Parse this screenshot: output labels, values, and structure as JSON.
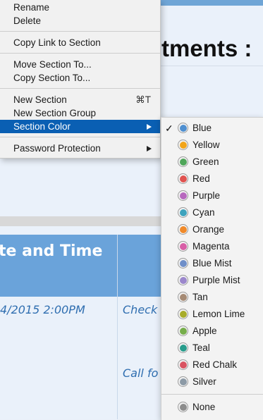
{
  "document": {
    "title": "tments :",
    "table_header": "te and Time",
    "row1_date": "4/2015 2:00PM",
    "row1_action": "Check",
    "row2_action": "Call fo"
  },
  "context_menu": {
    "rename": "Rename",
    "delete": "Delete",
    "copy_link": "Copy Link to Section",
    "move_section": "Move Section To...",
    "copy_section": "Copy Section To...",
    "new_section": "New Section",
    "new_section_shortcut": "⌘T",
    "new_section_group": "New Section Group",
    "section_color": "Section Color",
    "password_protection": "Password Protection"
  },
  "color_submenu": {
    "selected": "Blue",
    "check_glyph": "✓",
    "colors": [
      {
        "label": "Blue",
        "hex": "#4f8fd0"
      },
      {
        "label": "Yellow",
        "hex": "#f2a51a"
      },
      {
        "label": "Green",
        "hex": "#4fa65a"
      },
      {
        "label": "Red",
        "hex": "#e0524f"
      },
      {
        "label": "Purple",
        "hex": "#b768be"
      },
      {
        "label": "Cyan",
        "hex": "#3ea3bd"
      },
      {
        "label": "Orange",
        "hex": "#f08a2a"
      },
      {
        "label": "Magenta",
        "hex": "#d85ea6"
      },
      {
        "label": "Blue Mist",
        "hex": "#6f8fc9"
      },
      {
        "label": "Purple Mist",
        "hex": "#9b87cc"
      },
      {
        "label": "Tan",
        "hex": "#a58a74"
      },
      {
        "label": "Lemon Lime",
        "hex": "#a8ac2a"
      },
      {
        "label": "Apple",
        "hex": "#76ad4a"
      },
      {
        "label": "Teal",
        "hex": "#289c8c"
      },
      {
        "label": "Red Chalk",
        "hex": "#d95462"
      },
      {
        "label": "Silver",
        "hex": "#8c9aa6"
      }
    ],
    "none": {
      "label": "None",
      "hex": "#8c8c8c"
    }
  }
}
